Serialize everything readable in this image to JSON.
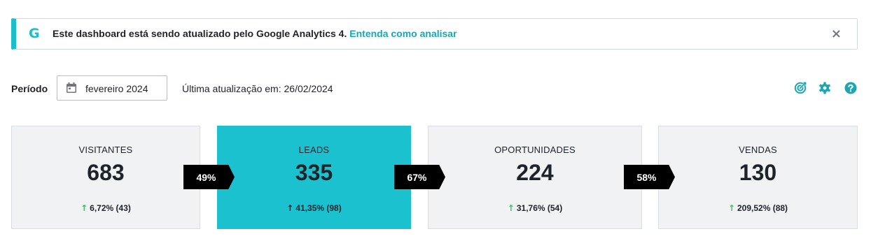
{
  "banner": {
    "icon": "google-g-icon",
    "message": "Este dashboard está sendo atualizado pelo Google Analytics 4.",
    "link": "Entenda como analisar",
    "close": "×",
    "accent": "#1bbfcb"
  },
  "filters": {
    "period_label": "Período",
    "period_value": "fevereiro 2024",
    "last_update": "Última atualização em: 26/02/2024"
  },
  "toolbar": {
    "icons": [
      "target-icon",
      "gear-icon",
      "help-icon"
    ],
    "color": "#1aa6b2"
  },
  "funnel": {
    "stages": [
      {
        "title": "VISITANTES",
        "value": "683",
        "change": "6,72% (43)"
      },
      {
        "title": "LEADS",
        "value": "335",
        "change": "41,35% (98)"
      },
      {
        "title": "OPORTUNIDADES",
        "value": "224",
        "change": "31,76% (54)"
      },
      {
        "title": "VENDAS",
        "value": "130",
        "change": "209,52% (88)"
      }
    ],
    "rates": [
      "49%",
      "67%",
      "58%"
    ],
    "arrow": "↑"
  }
}
